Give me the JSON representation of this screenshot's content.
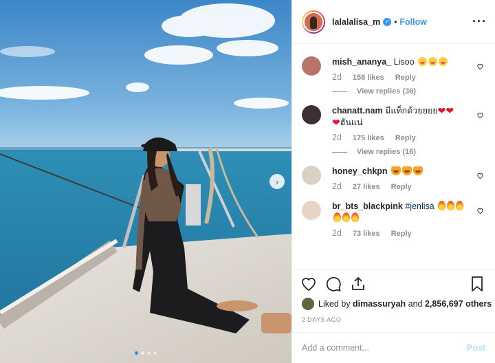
{
  "header": {
    "username": "lalalalisa_m",
    "separator": "•",
    "follow_label": "Follow",
    "more_icon": "more-icon"
  },
  "comments": [
    {
      "user": "mish_ananya_",
      "text": "Lisoo",
      "emojis": [
        "face",
        "face",
        "face"
      ],
      "age": "2d",
      "likes": "158 likes",
      "reply": "Reply",
      "view_replies": "View replies (36)"
    },
    {
      "user": "chanatt.nam",
      "text": "มีแท็กด้วยยยย",
      "emojis_after_text": [
        "heart",
        "heart"
      ],
      "line2_emoji": "heart",
      "line2_text": "ฮันแน่",
      "age": "2d",
      "likes": "175 likes",
      "reply": "Reply",
      "view_replies": "View replies (16)"
    },
    {
      "user": "honey_chkpn",
      "text": "",
      "emojis": [
        "cat",
        "cat",
        "cat"
      ],
      "age": "2d",
      "likes": "27 likes",
      "reply": "Reply"
    },
    {
      "user": "br_bts_blackpink",
      "tag": "#jenlisa",
      "emojis": [
        "fire",
        "fire",
        "fire",
        "fire",
        "fire",
        "fire"
      ],
      "age": "2d",
      "likes": "73 likes",
      "reply": "Reply"
    }
  ],
  "likes": {
    "prefix": "Liked by",
    "user": "dimassuryah",
    "middle": "and",
    "others": "2,856,697 others"
  },
  "timestamp": "2 DAYS AGO",
  "add_comment": {
    "placeholder": "Add a comment...",
    "post_label": "Post"
  },
  "carousel": {
    "total": 4,
    "active": 0
  },
  "colors": {
    "accent": "#3897f0",
    "muted": "#8e8e8e",
    "post_disabled": "#b2dffc"
  }
}
